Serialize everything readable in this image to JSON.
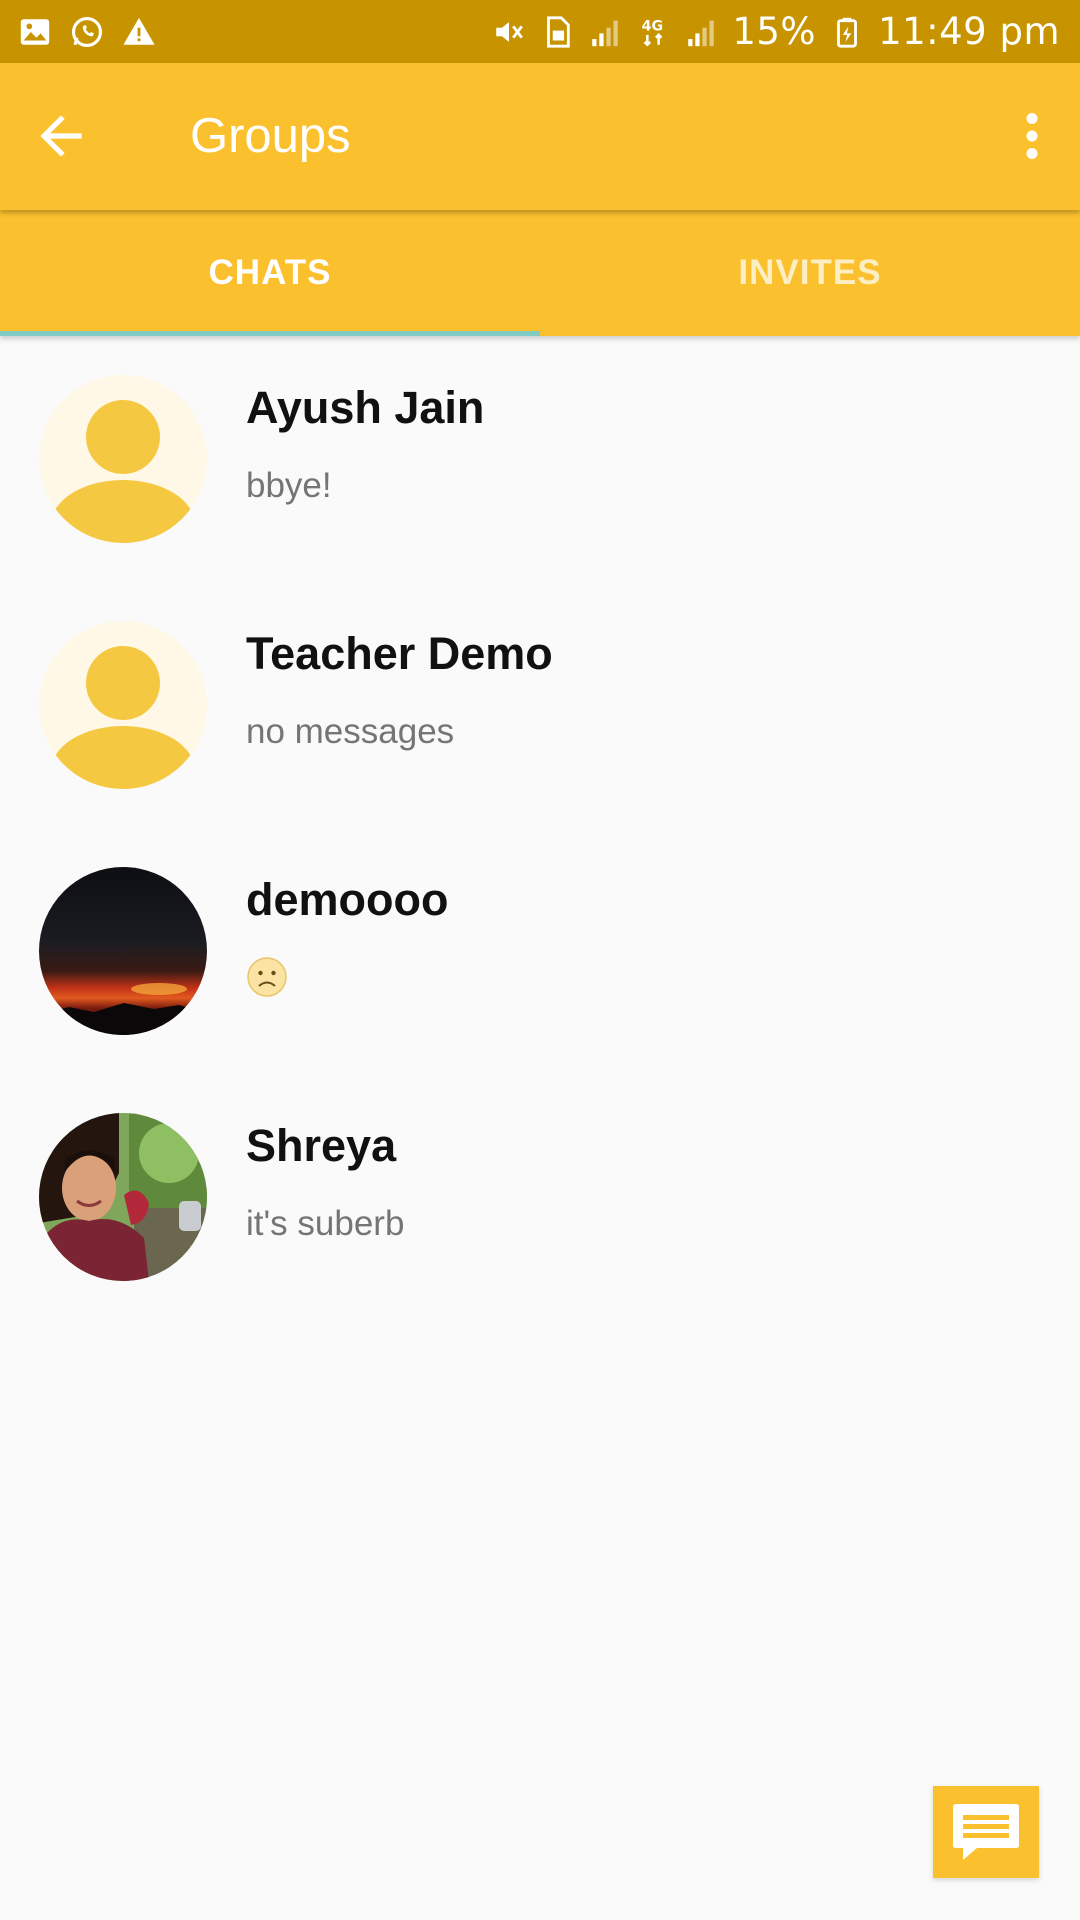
{
  "status_bar": {
    "battery": "15%",
    "time": "11:49 pm",
    "icons": [
      "image-icon",
      "whatsapp-icon",
      "warning-icon",
      "mute-icon",
      "sim-icon",
      "signal-icon",
      "4g-icon",
      "signal-icon",
      "battery-icon"
    ]
  },
  "app_bar": {
    "title": "Groups",
    "back_icon": "arrow-back-icon",
    "menu_icon": "more-vert-icon"
  },
  "tabs": [
    {
      "label": "CHATS",
      "active": true
    },
    {
      "label": "INVITES",
      "active": false
    }
  ],
  "chats": [
    {
      "name": "Ayush Jain",
      "message": "bbye!",
      "avatar": "default-avatar"
    },
    {
      "name": "Teacher Demo",
      "message": "no messages",
      "avatar": "default-avatar"
    },
    {
      "name": "demoooo",
      "message": "",
      "message_icon": "sad-face-emoji",
      "avatar": "sunset-photo"
    },
    {
      "name": "Shreya",
      "message": "it's suberb",
      "avatar": "profile-photo"
    }
  ],
  "fab": {
    "icon": "message-icon"
  },
  "colors": {
    "status_bar": "#C79400",
    "app_bar": "#FBC02D",
    "tab_indicator": "#80CBC4",
    "avatar_default": "#F5C842",
    "background": "#FAFAFA"
  }
}
